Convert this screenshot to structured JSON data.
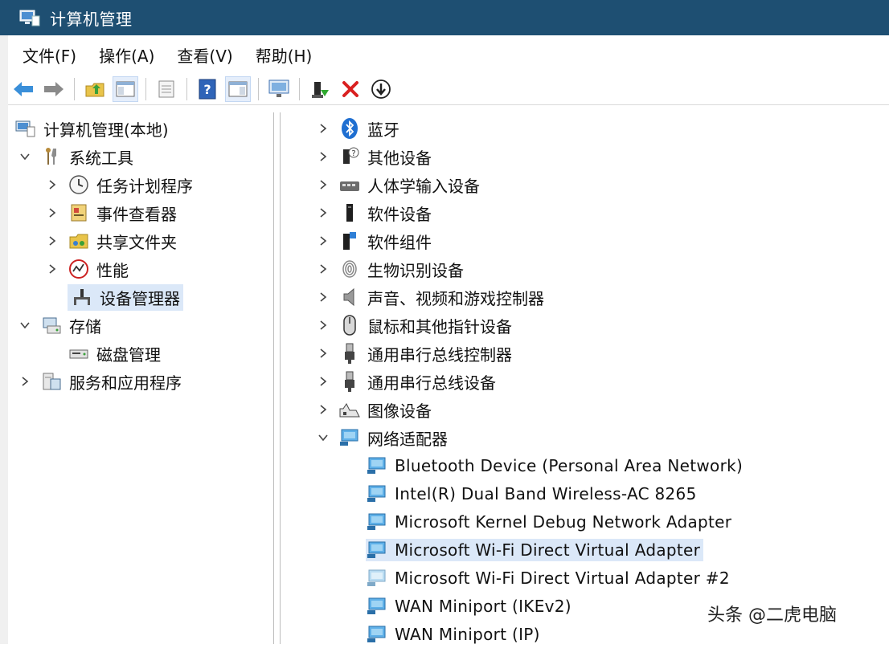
{
  "window": {
    "title": "计算机管理",
    "icon": "computer-management-icon"
  },
  "menu": [
    {
      "label": "文件(F)"
    },
    {
      "label": "操作(A)"
    },
    {
      "label": "查看(V)"
    },
    {
      "label": "帮助(H)"
    }
  ],
  "toolbar": [
    {
      "icon": "back-arrow-icon"
    },
    {
      "icon": "forward-arrow-icon"
    },
    {
      "icon": "up-folder-icon"
    },
    {
      "icon": "show-hide-console-tree-icon"
    },
    {
      "icon": "properties-icon"
    },
    {
      "icon": "help-icon"
    },
    {
      "icon": "show-hide-action-pane-icon"
    },
    {
      "icon": "monitor-icon"
    },
    {
      "icon": "update-driver-icon"
    },
    {
      "icon": "uninstall-icon"
    },
    {
      "icon": "download-icon"
    }
  ],
  "tree": {
    "root": "计算机管理(本地)",
    "system_tools": "系统工具",
    "task_scheduler": "任务计划程序",
    "event_viewer": "事件查看器",
    "shared_folders": "共享文件夹",
    "performance": "性能",
    "device_manager": "设备管理器",
    "storage": "存储",
    "disk_management": "磁盘管理",
    "services": "服务和应用程序"
  },
  "devices": {
    "categories": [
      "蓝牙",
      "其他设备",
      "人体学输入设备",
      "软件设备",
      "软件组件",
      "生物识别设备",
      "声音、视频和游戏控制器",
      "鼠标和其他指针设备",
      "通用串行总线控制器",
      "通用串行总线设备",
      "图像设备",
      "网络适配器"
    ],
    "network_adapters": [
      "Bluetooth Device (Personal Area Network)",
      "Intel(R) Dual Band Wireless-AC 8265",
      "Microsoft Kernel Debug Network Adapter",
      "Microsoft Wi-Fi Direct Virtual Adapter",
      "Microsoft Wi-Fi Direct Virtual Adapter #2",
      "WAN Miniport (IKEv2)",
      "WAN Miniport (IP)"
    ]
  },
  "watermark": "头条 @二虎电脑",
  "colors": {
    "titlebar": "#1e4f72",
    "selection": "#dbe8f8"
  }
}
